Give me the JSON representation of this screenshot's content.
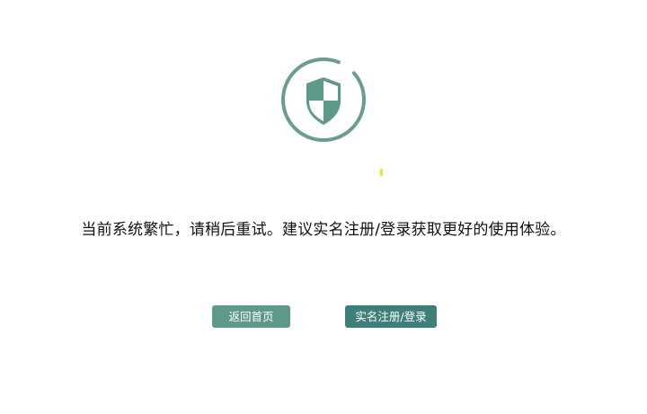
{
  "colors": {
    "accent": "#5e9a8a",
    "accent_dark": "#3f7f7a",
    "ring": "#6a9d90",
    "loading_dot": "#f2e02a"
  },
  "icon": {
    "name": "shield-icon"
  },
  "message": "当前系统繁忙，请稍后重试。建议实名注册/登录获取更好的使用体验。",
  "buttons": {
    "home_label": "返回首页",
    "register_label": "实名注册/登录"
  }
}
